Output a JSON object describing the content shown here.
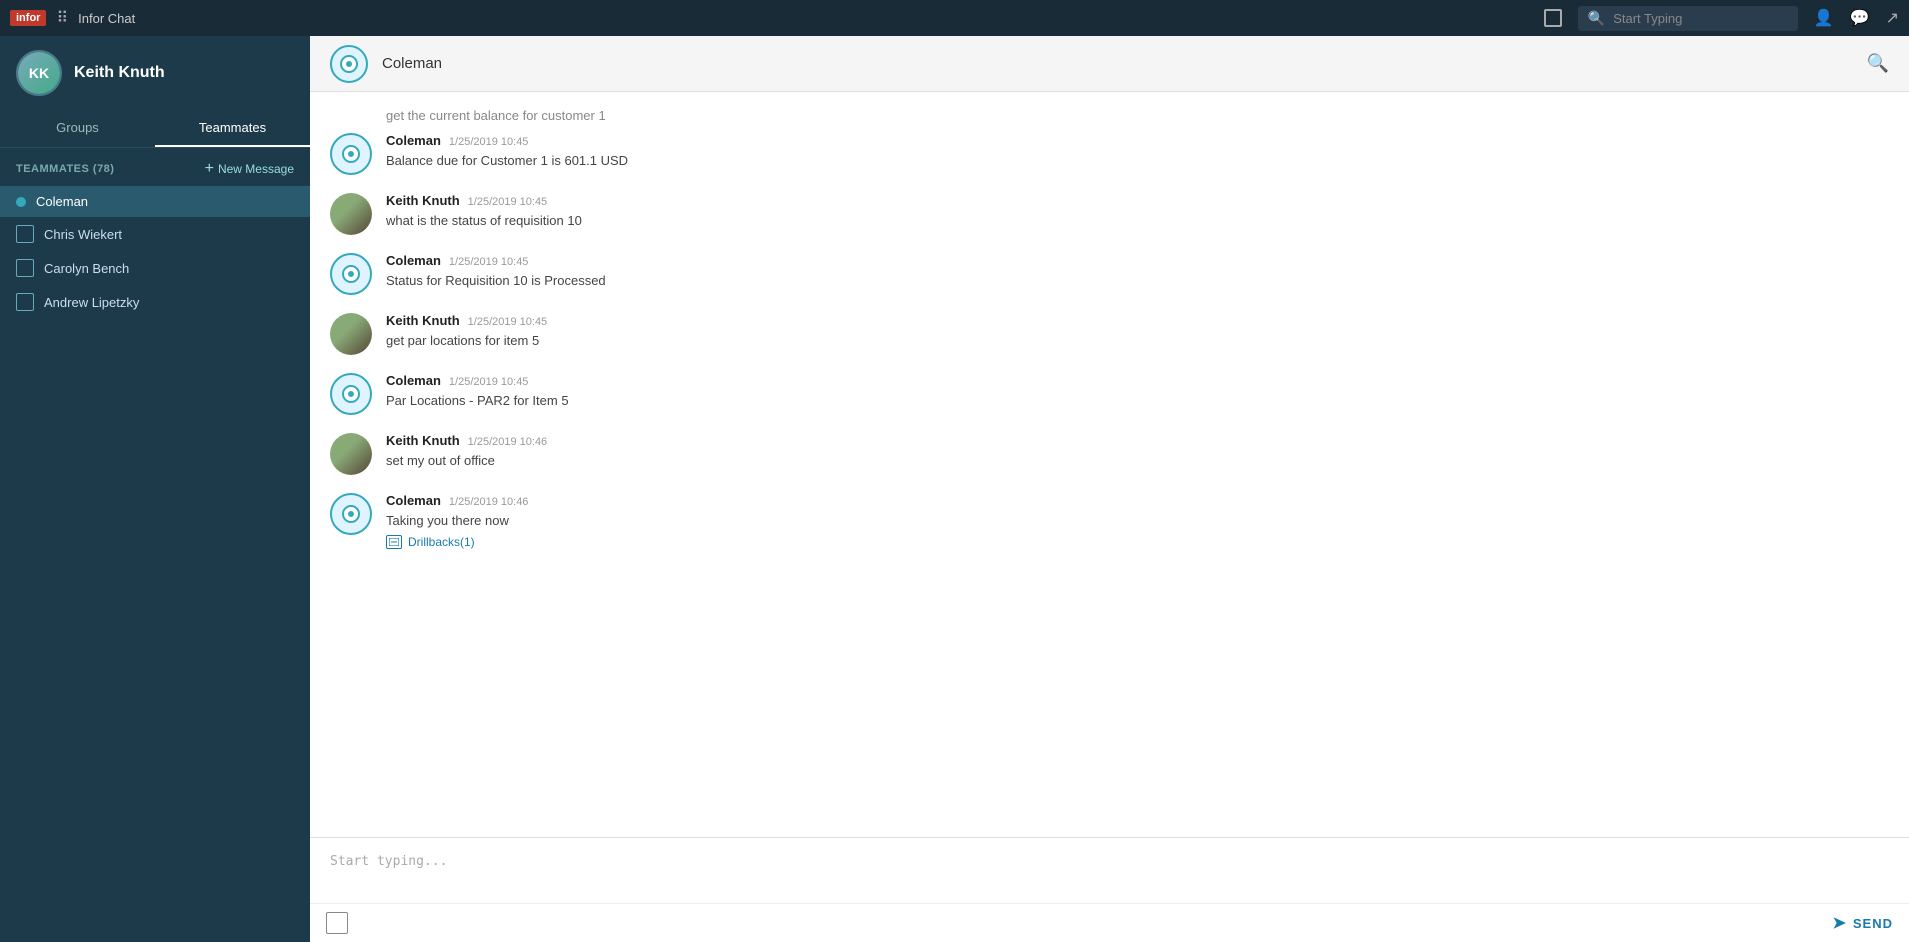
{
  "app": {
    "logo": "infor",
    "title": "Infor Chat"
  },
  "topnav": {
    "search_placeholder": "Start Typing"
  },
  "sidebar": {
    "user": {
      "name": "Keith Knuth"
    },
    "tabs": [
      {
        "label": "Groups",
        "active": false
      },
      {
        "label": "Teammates",
        "active": true
      }
    ],
    "section_title": "TEAMMATES (78)",
    "new_message_label": "New Message",
    "contacts": [
      {
        "name": "Coleman",
        "active": true,
        "type": "dot"
      },
      {
        "name": "Chris Wiekert",
        "active": false,
        "type": "square"
      },
      {
        "name": "Carolyn Bench",
        "active": false,
        "type": "square"
      },
      {
        "name": "Andrew Lipetzky",
        "active": false,
        "type": "square"
      }
    ]
  },
  "chat": {
    "contact_name": "Coleman",
    "messages": [
      {
        "id": "msg-truncated",
        "sender": "",
        "time": "",
        "text": "get the current balance for customer 1",
        "type": "truncated"
      },
      {
        "id": "msg-1",
        "sender": "Coleman",
        "time": "1/25/2019 10:45",
        "text": "Balance due for Customer 1 is 601.1 USD",
        "type": "bot"
      },
      {
        "id": "msg-2",
        "sender": "Keith Knuth",
        "time": "1/25/2019 10:45",
        "text": "what is the status of requisition 10",
        "type": "user"
      },
      {
        "id": "msg-3",
        "sender": "Coleman",
        "time": "1/25/2019 10:45",
        "text": "Status for Requisition 10 is Processed",
        "type": "bot"
      },
      {
        "id": "msg-4",
        "sender": "Keith Knuth",
        "time": "1/25/2019 10:45",
        "text": "get par locations for item 5",
        "type": "user"
      },
      {
        "id": "msg-5",
        "sender": "Coleman",
        "time": "1/25/2019 10:45",
        "text": "Par Locations - PAR2 for Item 5",
        "type": "bot"
      },
      {
        "id": "msg-6",
        "sender": "Keith Knuth",
        "time": "1/25/2019 10:46",
        "text": "set my out of office",
        "type": "user"
      },
      {
        "id": "msg-7",
        "sender": "Coleman",
        "time": "1/25/2019 10:46",
        "text": "Taking you there now",
        "type": "bot",
        "drillback": "Drillbacks(1)"
      }
    ],
    "input_placeholder": "Start typing...",
    "send_label": "SEND"
  }
}
